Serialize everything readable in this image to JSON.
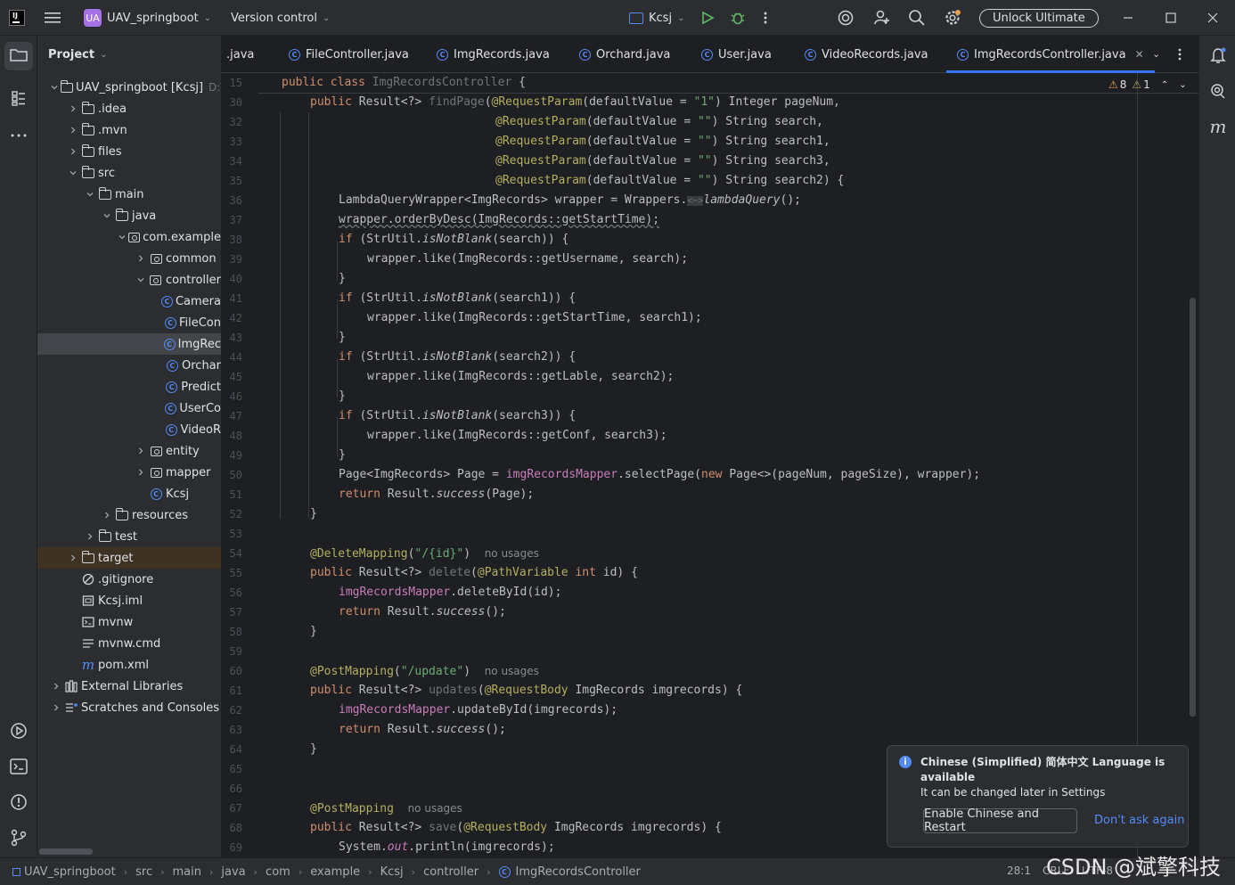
{
  "titlebar": {
    "project_badge": "UA",
    "project_name": "UAV_springboot",
    "vcs": "Version control",
    "run_config": "Kcsj",
    "unlock": "Unlock Ultimate"
  },
  "project_panel": {
    "title": "Project",
    "items": [
      {
        "label": "UAV_springboot [Kcsj]",
        "suffix": "D:\\",
        "depth": 0,
        "arrow": "down",
        "icon": "folder"
      },
      {
        "label": ".idea",
        "depth": 1,
        "arrow": "right",
        "icon": "folder"
      },
      {
        "label": ".mvn",
        "depth": 1,
        "arrow": "right",
        "icon": "folder"
      },
      {
        "label": "files",
        "depth": 1,
        "arrow": "right",
        "icon": "folder"
      },
      {
        "label": "src",
        "depth": 1,
        "arrow": "down",
        "icon": "folder"
      },
      {
        "label": "main",
        "depth": 2,
        "arrow": "down",
        "icon": "folder"
      },
      {
        "label": "java",
        "depth": 3,
        "arrow": "down",
        "icon": "folder"
      },
      {
        "label": "com.example",
        "depth": 4,
        "arrow": "down",
        "icon": "pkg"
      },
      {
        "label": "common",
        "depth": 5,
        "arrow": "right",
        "icon": "pkg"
      },
      {
        "label": "controller",
        "depth": 5,
        "arrow": "down",
        "icon": "pkg"
      },
      {
        "label": "Camera",
        "depth": 6,
        "arrow": "",
        "icon": "class"
      },
      {
        "label": "FileCon",
        "depth": 6,
        "arrow": "",
        "icon": "class"
      },
      {
        "label": "ImgRec",
        "depth": 6,
        "arrow": "",
        "icon": "class",
        "selected": true
      },
      {
        "label": "Orchar",
        "depth": 6,
        "arrow": "",
        "icon": "class"
      },
      {
        "label": "Predict",
        "depth": 6,
        "arrow": "",
        "icon": "class"
      },
      {
        "label": "UserCo",
        "depth": 6,
        "arrow": "",
        "icon": "class"
      },
      {
        "label": "VideoR",
        "depth": 6,
        "arrow": "",
        "icon": "class"
      },
      {
        "label": "entity",
        "depth": 5,
        "arrow": "right",
        "icon": "pkg"
      },
      {
        "label": "mapper",
        "depth": 5,
        "arrow": "right",
        "icon": "pkg"
      },
      {
        "label": "Kcsj",
        "depth": 5,
        "arrow": "",
        "icon": "class"
      },
      {
        "label": "resources",
        "depth": 3,
        "arrow": "right",
        "icon": "folder"
      },
      {
        "label": "test",
        "depth": 2,
        "arrow": "right",
        "icon": "folder"
      },
      {
        "label": "target",
        "depth": 1,
        "arrow": "right",
        "icon": "folder",
        "highlight": true
      },
      {
        "label": ".gitignore",
        "depth": 1,
        "arrow": "",
        "icon": "ignore"
      },
      {
        "label": "Kcsj.iml",
        "depth": 1,
        "arrow": "",
        "icon": "file"
      },
      {
        "label": "mvnw",
        "depth": 1,
        "arrow": "",
        "icon": "term"
      },
      {
        "label": "mvnw.cmd",
        "depth": 1,
        "arrow": "",
        "icon": "lines"
      },
      {
        "label": "pom.xml",
        "depth": 1,
        "arrow": "",
        "icon": "maven"
      },
      {
        "label": "External Libraries",
        "depth": 0,
        "arrow": "right",
        "icon": "lib"
      },
      {
        "label": "Scratches and Consoles",
        "depth": 0,
        "arrow": "right",
        "icon": "scratch"
      }
    ]
  },
  "tabs": [
    {
      "label": ".java",
      "icon": false
    },
    {
      "label": "FileController.java",
      "icon": true
    },
    {
      "label": "ImgRecords.java",
      "icon": true
    },
    {
      "label": "Orchard.java",
      "icon": true
    },
    {
      "label": "User.java",
      "icon": true
    },
    {
      "label": "VideoRecords.java",
      "icon": true
    },
    {
      "label": "ImgRecordsController.java",
      "icon": true,
      "active": true
    }
  ],
  "editor": {
    "warnings": "8",
    "weak_warnings": "1",
    "line_numbers": [
      "15",
      "30",
      "32",
      "33",
      "34",
      "35",
      "36",
      "37",
      "38",
      "39",
      "40",
      "41",
      "42",
      "43",
      "44",
      "45",
      "46",
      "47",
      "48",
      "49",
      "50",
      "51",
      "52",
      "53",
      "54",
      "55",
      "56",
      "57",
      "58",
      "59",
      "60",
      "61",
      "62",
      "63",
      "64",
      "65",
      "66",
      "67",
      "68",
      "69"
    ]
  },
  "notification": {
    "title": "Chinese (Simplified) 简体中文 Language is available",
    "body": "It can be changed later in Settings",
    "primary": "Enable Chinese and Restart",
    "secondary": "Don't ask again"
  },
  "statusbar": {
    "breadcrumbs": [
      "UAV_springboot",
      "src",
      "main",
      "java",
      "com",
      "example",
      "Kcsj",
      "controller",
      "ImgRecordsController"
    ],
    "position": "28:1",
    "crlf": "CRLF",
    "encoding": "UTF-8",
    "watermark": "CSDN @斌擎科技"
  }
}
